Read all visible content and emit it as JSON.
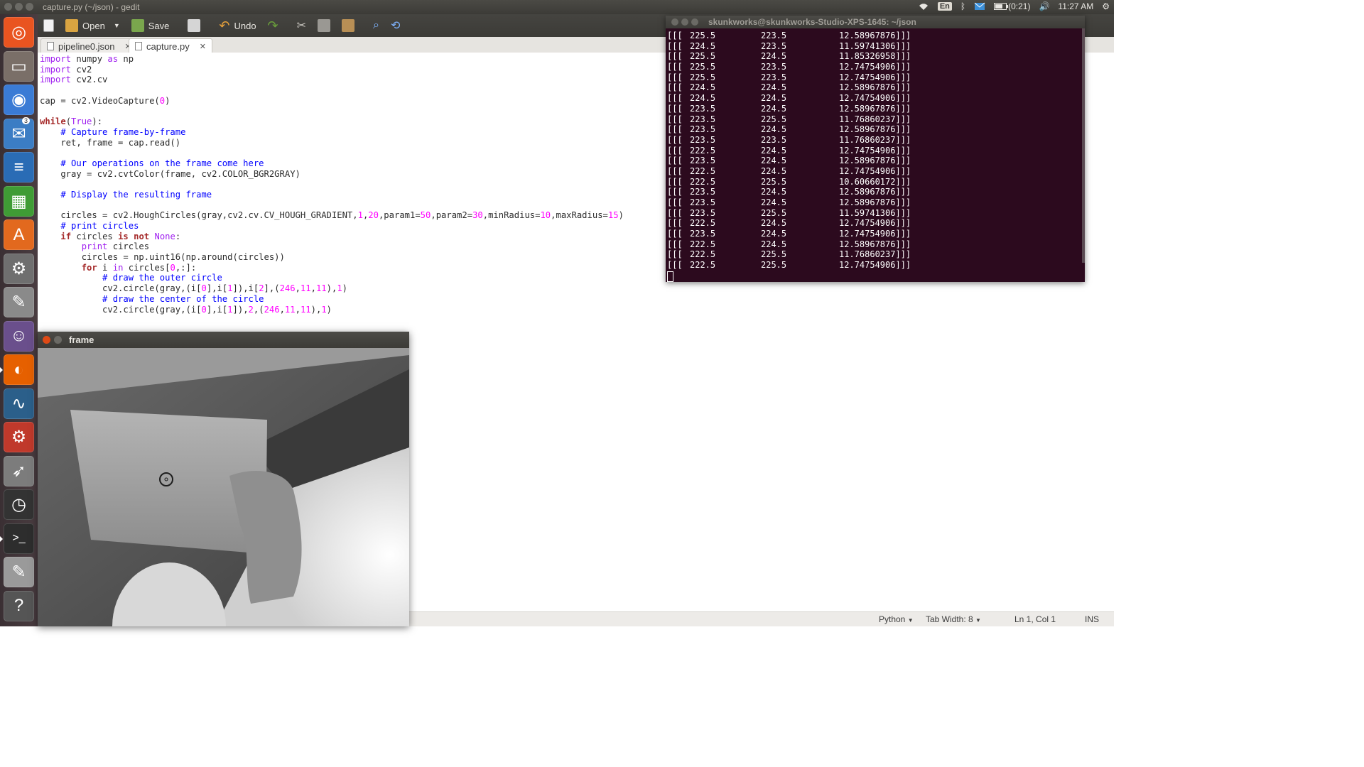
{
  "top_panel": {
    "window_title": "capture.py (~/json) - gedit",
    "keyboard_layout": "En",
    "battery": "(0:21)",
    "clock": "11:27 AM"
  },
  "launcher": {
    "items": [
      {
        "name": "ubuntu-dash",
        "color": "#e95420",
        "glyph": "◎"
      },
      {
        "name": "files",
        "color": "#7a6f68",
        "glyph": "▭"
      },
      {
        "name": "chromium",
        "color": "#3a7bd5",
        "glyph": "◉"
      },
      {
        "name": "thunderbird",
        "color": "#3b7dc4",
        "glyph": "✉",
        "badge": "3"
      },
      {
        "name": "libreoffice-writer",
        "color": "#2a6cb5",
        "glyph": "≡"
      },
      {
        "name": "libreoffice-calc",
        "color": "#3f9c35",
        "glyph": "▦"
      },
      {
        "name": "software-center",
        "color": "#e2691e",
        "glyph": "A"
      },
      {
        "name": "system-settings",
        "color": "#6f6f6f",
        "glyph": "⚙"
      },
      {
        "name": "tools",
        "color": "#8a8a8a",
        "glyph": "✎"
      },
      {
        "name": "pidgin",
        "color": "#6a4f8c",
        "glyph": "☺"
      },
      {
        "name": "firefox",
        "color": "#e66000",
        "glyph": "◐"
      },
      {
        "name": "system-monitor",
        "color": "#2b5f8a",
        "glyph": "∿"
      },
      {
        "name": "filezilla",
        "color": "#c0392b",
        "glyph": "⚙"
      },
      {
        "name": "rocket-app",
        "color": "#7c7c7c",
        "glyph": "➶"
      },
      {
        "name": "clock-app",
        "color": "#333333",
        "glyph": "◷"
      },
      {
        "name": "terminal",
        "color": "#2d2d2d",
        "glyph": ">_"
      },
      {
        "name": "text-editor",
        "color": "#9a9a9a",
        "glyph": "✎"
      },
      {
        "name": "help",
        "color": "#555555",
        "glyph": "?"
      }
    ]
  },
  "toolbar": {
    "open_label": "Open",
    "save_label": "Save",
    "undo_label": "Undo"
  },
  "tabs": [
    {
      "label": "pipeline0.json",
      "active": false
    },
    {
      "label": "capture.py",
      "active": true
    }
  ],
  "code_lines": [
    "import numpy as np",
    "import cv2",
    "import cv2.cv",
    "",
    "cap = cv2.VideoCapture(0)",
    "",
    "while(True):",
    "    # Capture frame-by-frame",
    "    ret, frame = cap.read()",
    "",
    "    # Our operations on the frame come here",
    "    gray = cv2.cvtColor(frame, cv2.COLOR_BGR2GRAY)",
    "",
    "    # Display the resulting frame",
    "",
    "    circles = cv2.HoughCircles(gray,cv2.cv.CV_HOUGH_GRADIENT,1,20,param1=50,param2=30,minRadius=10,maxRadius=15)",
    "    # print circles",
    "    if circles is not None:",
    "        print circles",
    "        circles = np.uint16(np.around(circles))",
    "        for i in circles[0,:]:",
    "            # draw the outer circle",
    "            cv2.circle(gray,(i[0],i[1]),i[2],(246,11,11),1)",
    "            # draw the center of the circle",
    "            cv2.circle(gray,(i[0],i[1]),2,(246,11,11),1)"
  ],
  "statusbar": {
    "language": "Python",
    "tab_width": "Tab Width: 8",
    "position": "Ln 1, Col 1",
    "mode": "INS"
  },
  "terminal": {
    "title": "skunkworks@skunkworks-Studio-XPS-1645: ~/json",
    "prefix": "[[[",
    "suffix": "]]]",
    "rows": [
      [
        "225.5",
        "223.5",
        "12.58967876"
      ],
      [
        "224.5",
        "223.5",
        "11.59741306"
      ],
      [
        "225.5",
        "224.5",
        "11.85326958"
      ],
      [
        "225.5",
        "223.5",
        "12.74754906"
      ],
      [
        "225.5",
        "223.5",
        "12.74754906"
      ],
      [
        "224.5",
        "224.5",
        "12.58967876"
      ],
      [
        "224.5",
        "224.5",
        "12.74754906"
      ],
      [
        "223.5",
        "224.5",
        "12.58967876"
      ],
      [
        "223.5",
        "225.5",
        "11.76860237"
      ],
      [
        "223.5",
        "224.5",
        "12.58967876"
      ],
      [
        "223.5",
        "223.5",
        "11.76860237"
      ],
      [
        "222.5",
        "224.5",
        "12.74754906"
      ],
      [
        "223.5",
        "224.5",
        "12.58967876"
      ],
      [
        "222.5",
        "224.5",
        "12.74754906"
      ],
      [
        "222.5",
        "225.5",
        "10.60660172"
      ],
      [
        "223.5",
        "224.5",
        "12.58967876"
      ],
      [
        "223.5",
        "224.5",
        "12.58967876"
      ],
      [
        "223.5",
        "225.5",
        "11.59741306"
      ],
      [
        "222.5",
        "224.5",
        "12.74754906"
      ],
      [
        "223.5",
        "224.5",
        "12.74754906"
      ],
      [
        "222.5",
        "224.5",
        "12.58967876"
      ],
      [
        "222.5",
        "225.5",
        "11.76860237"
      ],
      [
        "222.5",
        "225.5",
        "12.74754906"
      ]
    ]
  },
  "frame_window": {
    "title": "frame"
  },
  "colors": {
    "terminal_bg": "#2c0a1e",
    "panel_bg": "#3c3b37",
    "close_button": "#df4a16"
  }
}
